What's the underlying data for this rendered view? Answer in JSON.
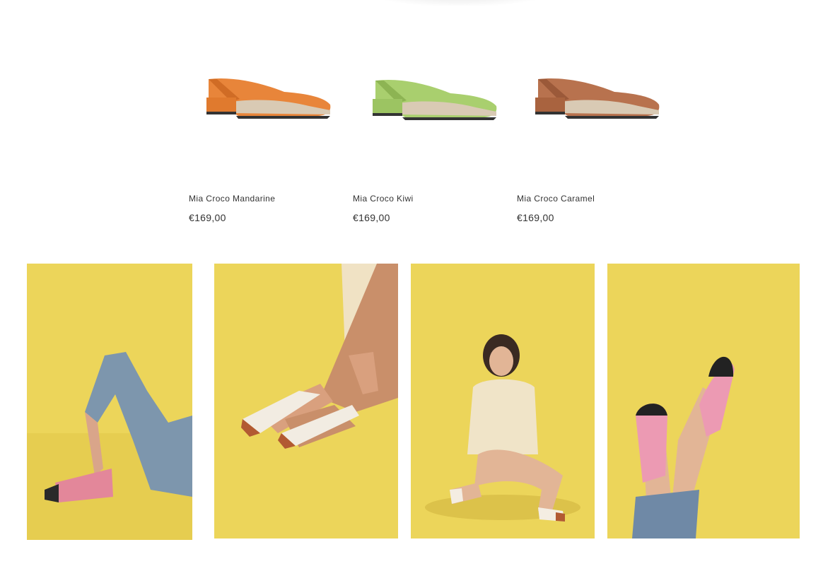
{
  "products": [
    {
      "name": "Mia Croco Mandarine",
      "price": "€169,00",
      "color": "#e8853a",
      "shade": "#c96520"
    },
    {
      "name": "Mia Croco Kiwi",
      "price": "€169,00",
      "color": "#a9cf6e",
      "shade": "#86ad4c"
    },
    {
      "name": "Mia Croco Caramel",
      "price": "€169,00",
      "color": "#b8724e",
      "shade": "#945234"
    }
  ],
  "lookbook": {
    "background": "#ecd55a",
    "photos": [
      {
        "subject": "reclining-jeans-pink-mary-jane"
      },
      {
        "subject": "crossed-legs-white-flats"
      },
      {
        "subject": "seated-model-cream-knit"
      },
      {
        "subject": "raised-legs-pink-heels"
      }
    ]
  }
}
